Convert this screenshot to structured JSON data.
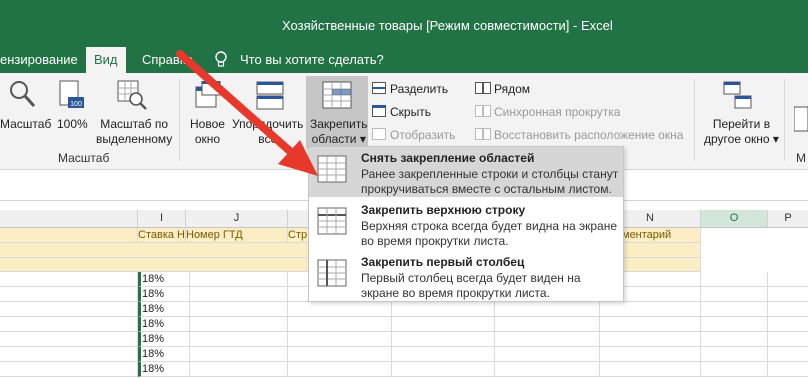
{
  "window": {
    "title": "Хозяйственные товары  [Режим совместимости]  -  Excel"
  },
  "tabs": [
    {
      "label": "ензирование"
    },
    {
      "label": "Вид"
    },
    {
      "label": "Справка"
    },
    {
      "label": "Что вы хотите сделать?"
    }
  ],
  "ribbon": {
    "zoom": {
      "label": "Масштаб"
    },
    "zoom100": {
      "label": "100%"
    },
    "zoom_selection": {
      "line1": "Масштаб по",
      "line2": "выделенному"
    },
    "zoom_group": "Масштаб",
    "new_window": {
      "line1": "Новое",
      "line2": "окно"
    },
    "arrange_all": {
      "line1": "Упорядочить",
      "line2": "все"
    },
    "freeze": {
      "line1": "Закрепить",
      "line2": "области"
    },
    "split": "Разделить",
    "hide": "Скрыть",
    "unhide": "Отобразить",
    "side_by_side": "Рядом",
    "sync_scroll": "Синхронная прокрутка",
    "reset_position": "Восстановить расположение окна",
    "switch_windows": {
      "line1": "Перейти в",
      "line2": "другое окно"
    },
    "m_label": "М"
  },
  "freeze_menu": {
    "items": [
      {
        "title": "Снять закрепление областей",
        "desc": "Ранее закрепленные строки и столбцы станут прокручиваться вместе с остальным листом."
      },
      {
        "title": "Закрепить верхнюю строку",
        "desc": "Верхняя строка всегда будет видна на экране во время прокрутки листа."
      },
      {
        "title": "Закрепить первый столбец",
        "desc": "Первый столбец всегда будет виден на экране во время прокрутки листа."
      }
    ]
  },
  "sheet": {
    "columns": [
      "I",
      "J",
      "N",
      "O",
      "P"
    ],
    "headers": {
      "I": "Ставка Н",
      "J": "Номер ГТД",
      "K": "Стр",
      "N": "ментарий"
    },
    "vat_values": [
      "18%",
      "18%",
      "18%",
      "18%",
      "18%",
      "18%",
      "18%"
    ]
  },
  "colors": {
    "accent": "#217346",
    "header_fill": "#fbeec4",
    "arrow": "#e8382c"
  }
}
